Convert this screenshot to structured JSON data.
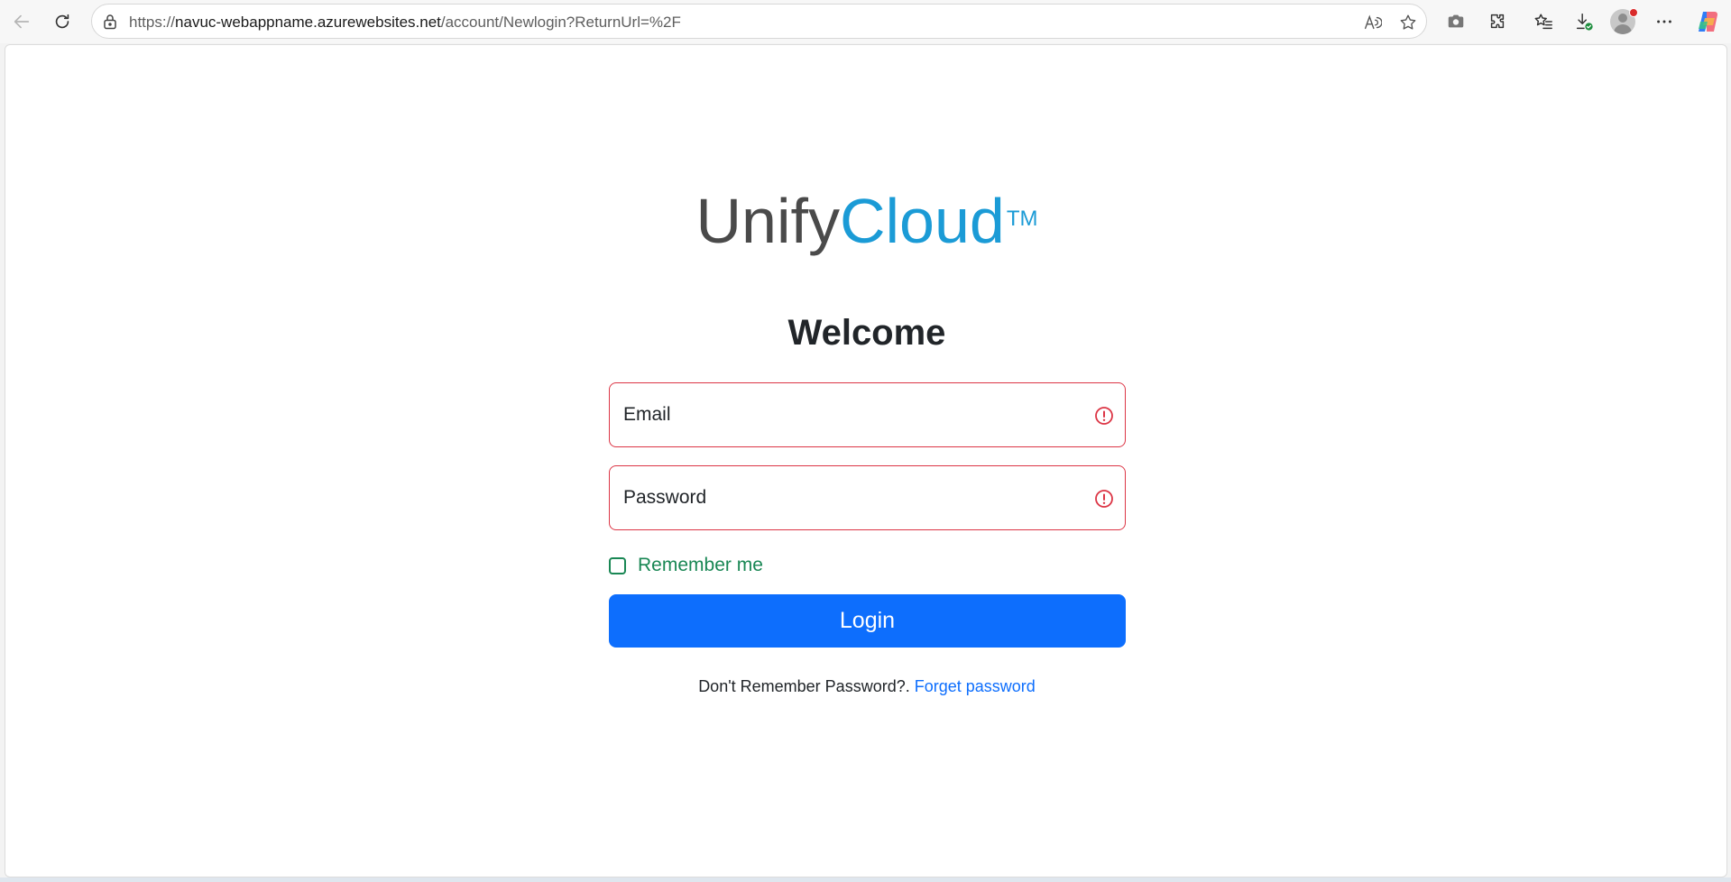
{
  "browser": {
    "url_prefix": "https://",
    "url_host": "navuc-webappname.azurewebsites.net",
    "url_path": "/account/Newlogin?ReturnUrl=%2F",
    "icons": [
      "back-icon",
      "refresh-icon",
      "site-info-lock-icon",
      "read-aloud-icon",
      "favorite-star-icon",
      "screenshot-camera-icon",
      "extensions-puzzle-icon",
      "favorites-list-icon",
      "downloads-icon",
      "profile-avatar",
      "more-options-icon",
      "copilot-icon"
    ]
  },
  "brand": {
    "part1": "Unify",
    "part2": "Cloud",
    "trademark": "TM"
  },
  "form": {
    "heading": "Welcome",
    "email_placeholder": "Email",
    "password_placeholder": "Password",
    "remember_label": "Remember me",
    "login_label": "Login",
    "forgot_prompt": "Don't Remember Password?.",
    "forgot_link": "Forget password"
  },
  "colors": {
    "brand_gray": "#4a4a4a",
    "brand_blue": "#1b9bd6",
    "error_red": "#dc3545",
    "success_green": "#198754",
    "primary_blue": "#0d6efd"
  }
}
